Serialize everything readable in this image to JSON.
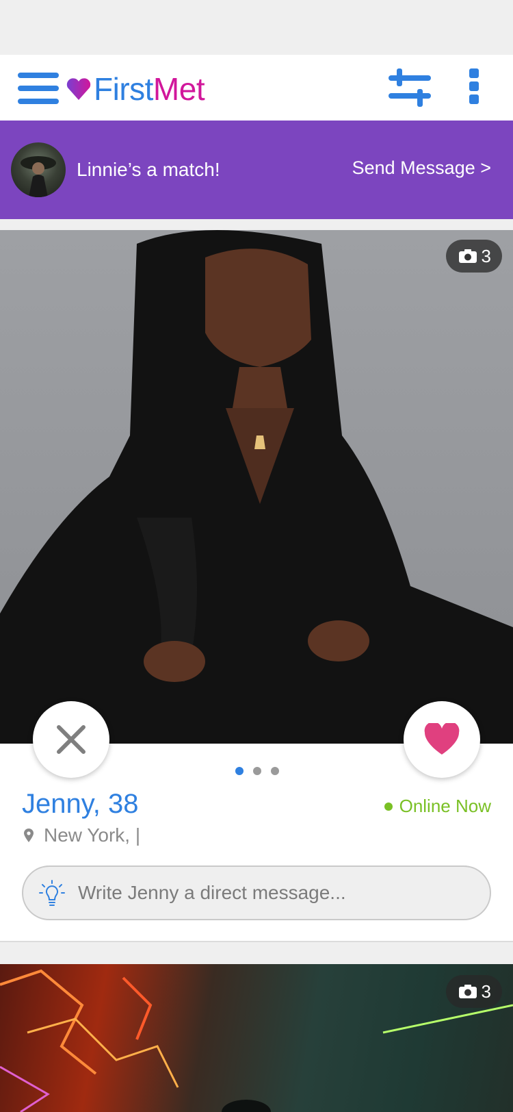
{
  "app": {
    "brand_first": "First",
    "brand_met": "Met",
    "colors": {
      "primary": "#2f80e0",
      "brand_pink": "#d1179b",
      "banner": "#7c45bf",
      "online": "#7ac025",
      "like": "#e0407f"
    },
    "icons": {
      "menu": "hamburger-icon",
      "filters": "sliders-icon",
      "more": "more-vertical-icon"
    }
  },
  "match_banner": {
    "text": "Linnie’s a match!",
    "action": "Send Message >"
  },
  "profile": {
    "name_age": "Jenny, 38",
    "status": "Online Now",
    "location": "New York, |",
    "photo_count": "3",
    "photo_index": 1,
    "photo_total": 3,
    "message_placeholder": "Write Jenny a direct message..."
  },
  "next_card": {
    "photo_count": "3"
  }
}
